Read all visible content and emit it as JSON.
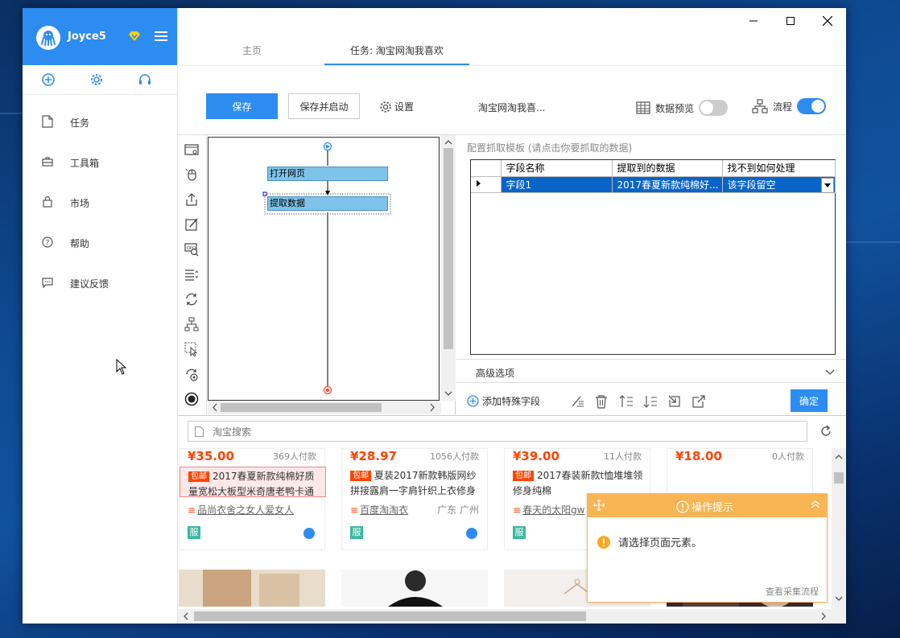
{
  "sidebar": {
    "username": "Joyce5",
    "nav": [
      {
        "label": "任务",
        "icon": "file-icon"
      },
      {
        "label": "工具箱",
        "icon": "toolbox-icon"
      },
      {
        "label": "市场",
        "icon": "bag-icon"
      },
      {
        "label": "帮助",
        "icon": "help-icon"
      },
      {
        "label": "建议反馈",
        "icon": "feedback-icon"
      }
    ]
  },
  "tabs": {
    "home": "主页",
    "task": "任务: 淘宝网淘我喜欢"
  },
  "toolbar": {
    "save": "保存",
    "save_start": "保存并启动",
    "settings": "设置",
    "task_name": "淘宝网淘我喜...",
    "preview": "数据预览",
    "preview_on": false,
    "flow": "流程",
    "flow_on": true
  },
  "workflow": {
    "nodes": [
      "打开网页",
      "提取数据"
    ]
  },
  "config": {
    "title": "配置抓取模板 (请点击你要抓取的数据)",
    "headers": [
      "字段名称",
      "提取到的数据",
      "找不到如何处理"
    ],
    "rows": [
      {
        "field": "字段1",
        "data": "2017春夏新款纯棉好...",
        "fallback": "该字段留空"
      }
    ],
    "advanced": "高级选项",
    "add_field": "添加特殊字段",
    "confirm": "确定"
  },
  "browser": {
    "search_placeholder": "淘宝搜索",
    "products": [
      {
        "price": "¥35.00",
        "sold": "369人付款",
        "tag": "包邮",
        "title": "2017春夏新款纯棉好质量宽松大板型米奇唐老鸭卡通",
        "shop": "品尚衣舍之女人爱女人",
        "loc": "",
        "service": "服"
      },
      {
        "price": "¥28.97",
        "sold": "1056人付款",
        "tag": "包邮",
        "title": "夏装2017新款韩版网纱拼接露肩一字肩针织上衣修身",
        "shop": "百度淘淘衣",
        "loc": "广东 广州",
        "service": "服"
      },
      {
        "price": "¥39.00",
        "sold": "11人付款",
        "tag": "包邮",
        "title": "2017春装新款t恤堆堆领修身纯棉",
        "shop": "春天的太阳gw",
        "loc": "",
        "service": "服"
      },
      {
        "price": "¥18.00",
        "sold": "0人付款",
        "tag": "",
        "title": "",
        "shop": "",
        "loc": "",
        "service": ""
      }
    ]
  },
  "tip": {
    "title": "操作提示",
    "message": "请选择页面元素。",
    "link": "查看采集流程"
  },
  "colors": {
    "accent": "#2d8cf0",
    "price": "#ff4400",
    "tip": "#f9b454",
    "row_selected": "#0a64c8"
  }
}
